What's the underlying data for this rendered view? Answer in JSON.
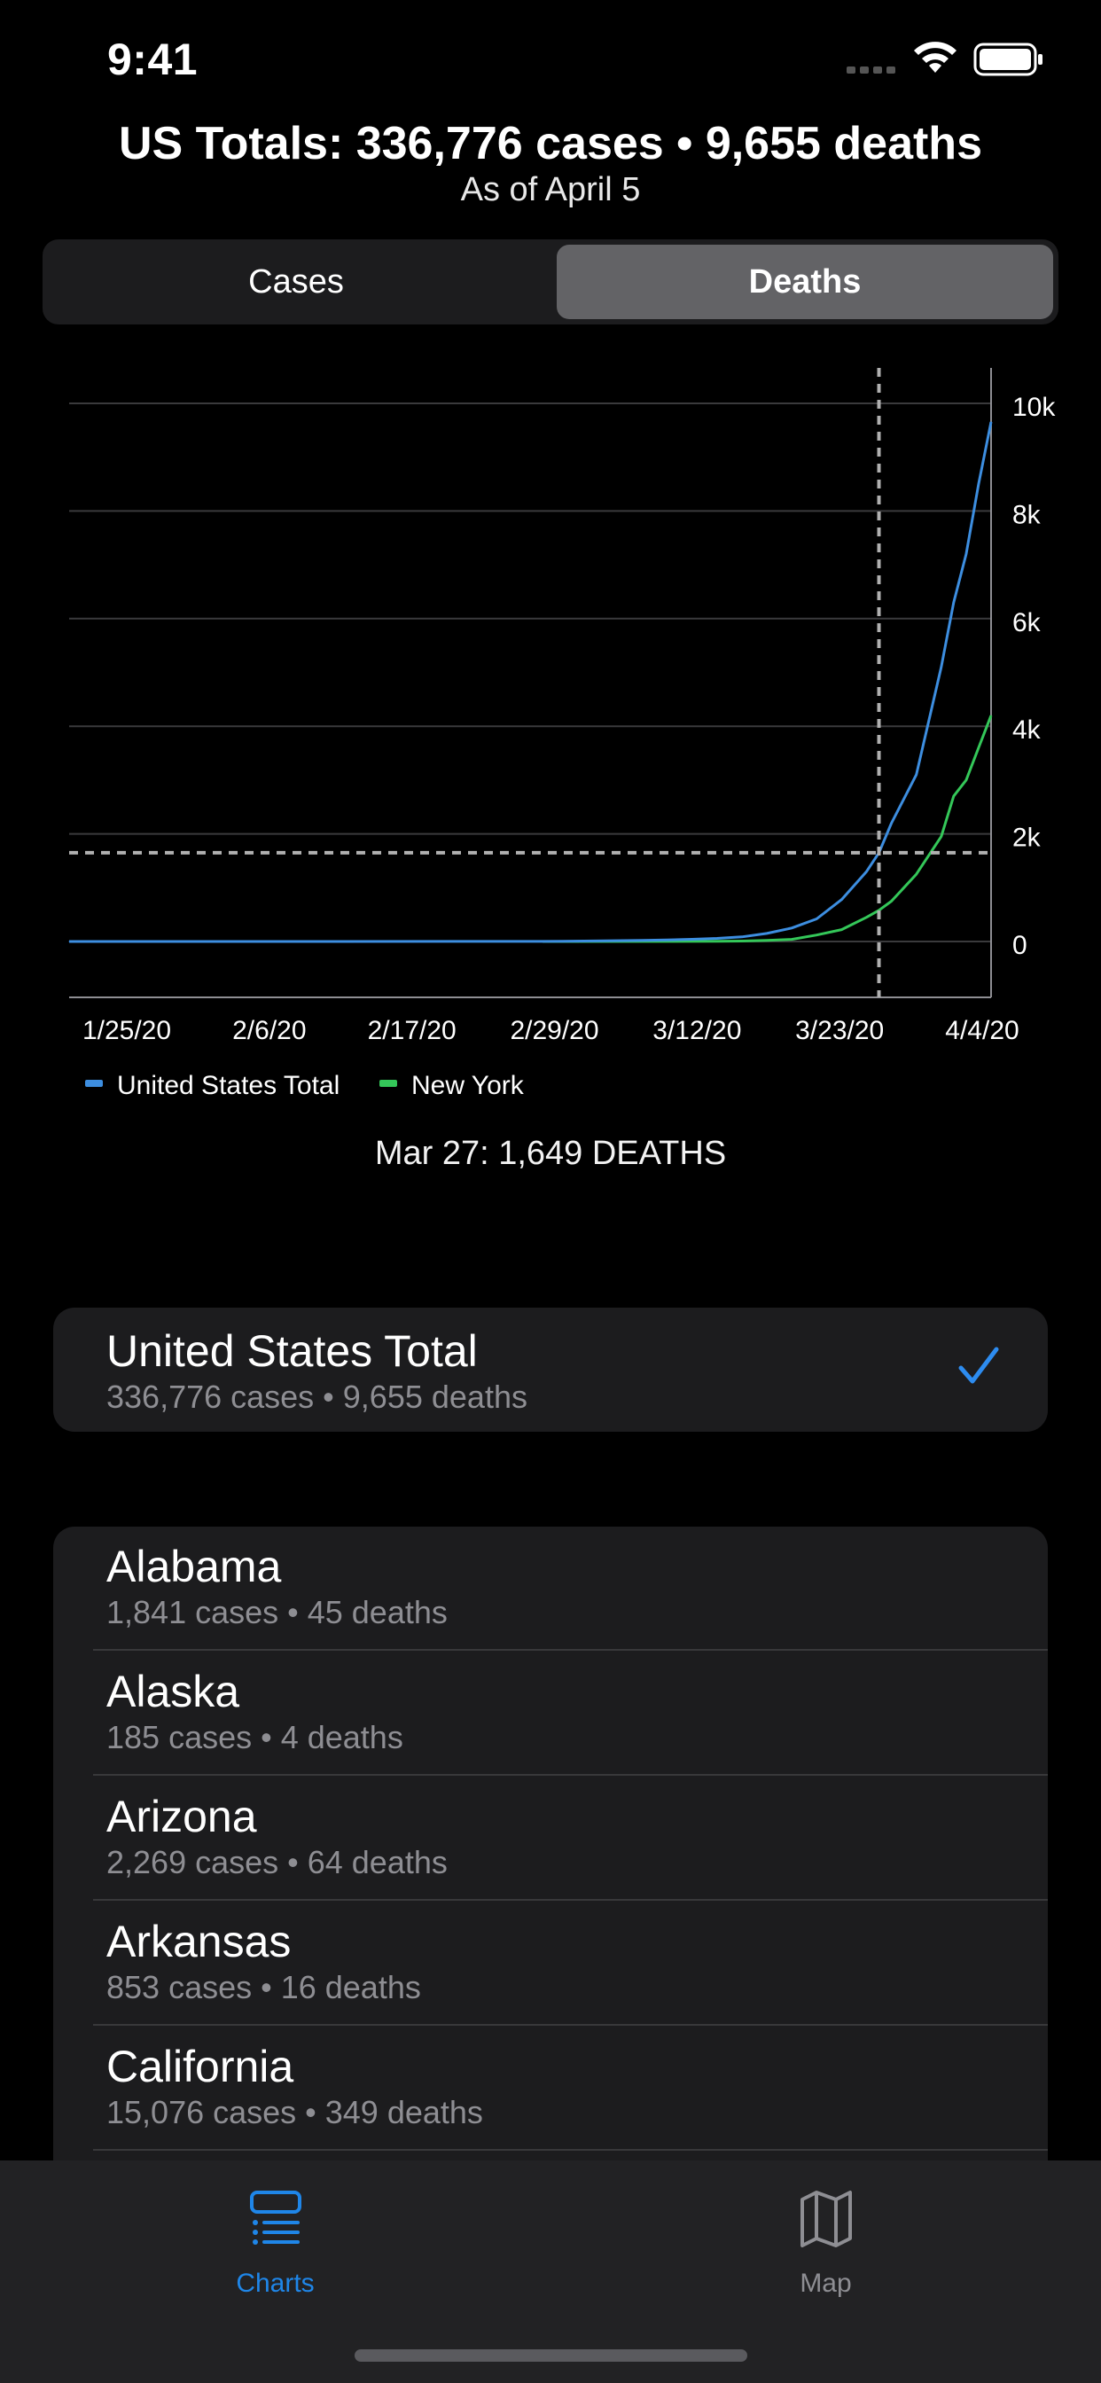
{
  "status_bar": {
    "time": "9:41"
  },
  "header": {
    "title": "US Totals: 336,776 cases • 9,655 deaths",
    "subtitle": "As of April 5"
  },
  "segmented_control": {
    "options": [
      "Cases",
      "Deaths"
    ],
    "selected": "Deaths"
  },
  "chart_data": {
    "type": "line",
    "x_tick_labels": [
      "1/25/20",
      "2/6/20",
      "2/17/20",
      "2/29/20",
      "3/12/20",
      "3/23/20",
      "4/4/20"
    ],
    "y_tick_labels": [
      "0",
      "2k",
      "4k",
      "6k",
      "8k",
      "10k"
    ],
    "ylim": [
      0,
      10000
    ],
    "x_range": [
      "2020-01-22",
      "2020-04-05"
    ],
    "grid": true,
    "legend_position": "bottom-left",
    "series": [
      {
        "name": "United States Total",
        "color": "#3d8ee0",
        "x": [
          "2020-01-22",
          "2020-02-29",
          "2020-03-05",
          "2020-03-08",
          "2020-03-10",
          "2020-03-12",
          "2020-03-14",
          "2020-03-16",
          "2020-03-18",
          "2020-03-20",
          "2020-03-22",
          "2020-03-24",
          "2020-03-26",
          "2020-03-27",
          "2020-03-28",
          "2020-03-30",
          "2020-04-01",
          "2020-04-02",
          "2020-04-03",
          "2020-04-04",
          "2020-04-05"
        ],
        "values": [
          0,
          1,
          12,
          21,
          30,
          41,
          57,
          85,
          150,
          250,
          420,
          780,
          1300,
          1649,
          2200,
          3100,
          5100,
          6300,
          7200,
          8500,
          9655
        ]
      },
      {
        "name": "New York",
        "color": "#34c759",
        "x": [
          "2020-02-29",
          "2020-03-14",
          "2020-03-16",
          "2020-03-18",
          "2020-03-20",
          "2020-03-22",
          "2020-03-24",
          "2020-03-26",
          "2020-03-27",
          "2020-03-28",
          "2020-03-30",
          "2020-04-01",
          "2020-04-02",
          "2020-04-03",
          "2020-04-04",
          "2020-04-05"
        ],
        "values": [
          0,
          3,
          8,
          20,
          40,
          120,
          220,
          450,
          580,
          750,
          1250,
          1950,
          2700,
          3000,
          3600,
          4200
        ]
      }
    ],
    "crosshair": {
      "x": "2020-03-27",
      "y": 1649
    }
  },
  "tooltip": {
    "text": "Mar 27: 1,649 DEATHS"
  },
  "us_total": {
    "name": "United States Total",
    "stats": "336,776 cases • 9,655 deaths",
    "selected": true,
    "accent": "#2d8cf0"
  },
  "states": [
    {
      "name": "Alabama",
      "stats": "1,841 cases • 45 deaths"
    },
    {
      "name": "Alaska",
      "stats": "185 cases • 4 deaths"
    },
    {
      "name": "Arizona",
      "stats": "2,269 cases • 64 deaths"
    },
    {
      "name": "Arkansas",
      "stats": "853 cases • 16 deaths"
    },
    {
      "name": "California",
      "stats": "15,076 cases • 349 deaths"
    }
  ],
  "tab_bar": {
    "tabs": [
      {
        "label": "Charts",
        "icon": "chart-list-icon",
        "active": true,
        "color": "#1f86e8"
      },
      {
        "label": "Map",
        "icon": "map-icon",
        "active": false,
        "color": "#8e8e93"
      }
    ]
  }
}
